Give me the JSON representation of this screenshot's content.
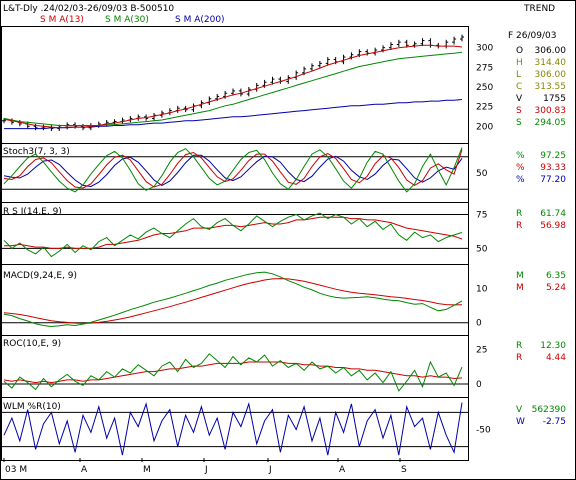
{
  "header": {
    "title": "L&T-Dly .24/02/03-26/09/03  B-500510",
    "sma13_label": "S M A(13)",
    "sma30_label": "S M A(30)",
    "sma200_label": "S M A(200)",
    "trend_label": "TREND"
  },
  "colors": {
    "frame": "#000000",
    "price_bars": "#000000",
    "sma13": "#cc0000",
    "sma30": "#008800",
    "sma200": "#0000aa",
    "k_line": "#008800",
    "d_line": "#cc0000",
    "slow_line": "#0000aa",
    "value_text": "#000000",
    "r_text": "#cc0000"
  },
  "info_panels": [
    {
      "date": "F 26/09/03",
      "rows": [
        {
          "k": "O",
          "v": "306.00",
          "color": "#000000"
        },
        {
          "k": "H",
          "v": "314.40",
          "color": "#888800"
        },
        {
          "k": "L",
          "v": "306.00",
          "color": "#888800"
        },
        {
          "k": "C",
          "v": "313.55",
          "color": "#888800"
        },
        {
          "k": "V",
          "v": "1755",
          "color": "#000000"
        },
        {
          "k": "S",
          "v": "300.83",
          "color": "#cc0000"
        },
        {
          "k": "S",
          "v": "294.05",
          "color": "#008800"
        }
      ]
    },
    {
      "rows": [
        {
          "k": "%",
          "v": "97.25",
          "color": "#008800"
        },
        {
          "k": "%",
          "v": "93.33",
          "color": "#cc0000"
        },
        {
          "k": "%",
          "v": "77.20",
          "color": "#0000aa"
        }
      ]
    },
    {
      "rows": [
        {
          "k": "R",
          "v": "61.74",
          "color": "#008800"
        },
        {
          "k": "R",
          "v": "56.98",
          "color": "#cc0000"
        }
      ]
    },
    {
      "rows": [
        {
          "k": "M",
          "v": "6.35",
          "color": "#008800"
        },
        {
          "k": "M",
          "v": "5.24",
          "color": "#cc0000"
        }
      ]
    },
    {
      "rows": [
        {
          "k": "R",
          "v": "12.30",
          "color": "#008800"
        },
        {
          "k": "R",
          "v": "4.44",
          "color": "#cc0000"
        }
      ]
    },
    {
      "rows": [
        {
          "k": "V",
          "v": "562390",
          "color": "#008800"
        },
        {
          "k": "W",
          "v": "-2.75",
          "color": "#0000aa"
        }
      ]
    }
  ],
  "chart_data": {
    "type": "line",
    "x_labels": [
      "03 M",
      "A",
      "M",
      "J",
      "J",
      "A",
      "S"
    ],
    "panels": [
      {
        "name": "price",
        "type": "ohlc",
        "ylim": [
          180,
          325
        ],
        "yticks": [
          200,
          225,
          250,
          275,
          300
        ],
        "close": [
          207,
          205,
          203,
          200,
          198,
          199,
          197,
          199,
          202,
          200,
          198,
          201,
          203,
          205,
          206,
          208,
          210,
          212,
          210,
          214,
          217,
          220,
          223,
          221,
          226,
          230,
          235,
          238,
          242,
          245,
          241,
          247,
          252,
          256,
          260,
          257,
          262,
          268,
          273,
          277,
          280,
          285,
          282,
          288,
          291,
          295,
          293,
          297,
          300,
          304,
          307,
          303,
          305,
          309,
          303,
          302,
          307,
          311,
          313.55
        ],
        "sma13": [
          209,
          207,
          205,
          203,
          201,
          200,
          199,
          198,
          199,
          199,
          199,
          200,
          201,
          203,
          204,
          206,
          208,
          210,
          211,
          213,
          215,
          217,
          220,
          222,
          225,
          228,
          231,
          234,
          237,
          240,
          242,
          245,
          248,
          251,
          254,
          257,
          260,
          263,
          267,
          270,
          274,
          278,
          281,
          284,
          287,
          290,
          292,
          294,
          296,
          298,
          300,
          301,
          302,
          303,
          303,
          302,
          302,
          302,
          300.83
        ],
        "sma30": [
          210,
          208,
          206,
          205,
          204,
          203,
          202,
          201,
          201,
          201,
          201,
          201,
          201,
          202,
          202,
          203,
          204,
          205,
          206,
          207,
          208,
          210,
          212,
          214,
          216,
          218,
          220,
          223,
          226,
          228,
          231,
          234,
          237,
          240,
          243,
          246,
          249,
          252,
          255,
          258,
          261,
          264,
          267,
          270,
          273,
          276,
          278,
          280,
          282,
          284,
          286,
          287,
          288,
          289,
          290,
          291,
          292,
          293,
          294.05
        ],
        "sma200": [
          197,
          197,
          197,
          197,
          197,
          197,
          198,
          198,
          198,
          199,
          199,
          199,
          200,
          200,
          201,
          201,
          202,
          202,
          203,
          204,
          204,
          205,
          206,
          207,
          207,
          208,
          209,
          210,
          211,
          212,
          212,
          213,
          214,
          215,
          216,
          217,
          218,
          219,
          220,
          221,
          222,
          223,
          224,
          225,
          226,
          226,
          227,
          228,
          228,
          229,
          230,
          230,
          231,
          231,
          232,
          232,
          233,
          233,
          234
        ]
      },
      {
        "name": "Stoch3(7, 3, 3)",
        "ylim": [
          0,
          100
        ],
        "yticks": [
          50
        ],
        "hlines": [
          20,
          80
        ],
        "k": [
          30,
          45,
          62,
          78,
          85,
          70,
          52,
          35,
          22,
          15,
          28,
          48,
          66,
          82,
          90,
          78,
          55,
          30,
          18,
          25,
          45,
          70,
          88,
          95,
          80,
          60,
          40,
          28,
          35,
          55,
          75,
          88,
          92,
          75,
          50,
          30,
          20,
          38,
          62,
          85,
          93,
          80,
          58,
          35,
          22,
          40,
          70,
          90,
          85,
          60,
          35,
          15,
          30,
          62,
          85,
          55,
          28,
          60,
          97.25
        ],
        "d": [
          40,
          38,
          45,
          62,
          75,
          78,
          69,
          52,
          36,
          24,
          22,
          30,
          47,
          65,
          79,
          83,
          74,
          54,
          34,
          24,
          29,
          47,
          68,
          84,
          88,
          78,
          60,
          43,
          34,
          39,
          55,
          73,
          85,
          85,
          72,
          52,
          33,
          29,
          40,
          62,
          80,
          86,
          77,
          58,
          38,
          32,
          44,
          67,
          82,
          78,
          60,
          37,
          27,
          36,
          59,
          67,
          56,
          48,
          93.33
        ],
        "slow": [
          45,
          42,
          41,
          48,
          61,
          72,
          74,
          66,
          51,
          37,
          27,
          25,
          33,
          47,
          64,
          76,
          79,
          70,
          54,
          37,
          27,
          35,
          51,
          69,
          83,
          83,
          72,
          56,
          41,
          36,
          43,
          57,
          71,
          81,
          80,
          70,
          52,
          38,
          34,
          44,
          61,
          76,
          81,
          72,
          55,
          43,
          38,
          48,
          64,
          76,
          74,
          58,
          41,
          33,
          41,
          54,
          61,
          57,
          77.2
        ]
      },
      {
        "name": "R S I(14,E, 9)",
        "ylim": [
          40,
          82
        ],
        "yticks": [
          50,
          75
        ],
        "hlines": [
          50,
          75
        ],
        "rsi": [
          56,
          50,
          54,
          49,
          46,
          51,
          44,
          48,
          53,
          47,
          52,
          49,
          55,
          58,
          52,
          56,
          60,
          57,
          62,
          65,
          61,
          58,
          63,
          68,
          72,
          66,
          64,
          69,
          72,
          67,
          63,
          68,
          74,
          70,
          66,
          70,
          73,
          75,
          71,
          74,
          76,
          72,
          75,
          73,
          68,
          72,
          66,
          70,
          64,
          68,
          60,
          56,
          62,
          58,
          60,
          55,
          58,
          60,
          61.74
        ],
        "signal": [
          52,
          52,
          53,
          52,
          51,
          51,
          50,
          50,
          51,
          50,
          50,
          50,
          51,
          53,
          53,
          54,
          55,
          56,
          58,
          60,
          61,
          61,
          62,
          63,
          65,
          65,
          65,
          66,
          67,
          67,
          66,
          67,
          68,
          69,
          68,
          68,
          69,
          71,
          71,
          72,
          73,
          73,
          73,
          73,
          72,
          72,
          71,
          71,
          70,
          69,
          67,
          65,
          64,
          63,
          62,
          61,
          60,
          59,
          56.98
        ]
      },
      {
        "name": "MACD(9,24,E, 9)",
        "ylim": [
          -3,
          16
        ],
        "yticks": [
          10,
          0
        ],
        "hlines": [
          0
        ],
        "macd": [
          2.5,
          2.1,
          1.2,
          0.5,
          -0.3,
          -0.8,
          -1.1,
          -0.9,
          -0.6,
          -0.8,
          -0.4,
          0.1,
          0.8,
          1.5,
          2.2,
          3.0,
          3.8,
          4.5,
          5.2,
          6.0,
          6.6,
          7.2,
          7.9,
          8.6,
          9.4,
          10.1,
          10.9,
          11.6,
          12.4,
          13.0,
          13.6,
          14.2,
          14.6,
          14.8,
          14.3,
          13.4,
          12.3,
          11.4,
          10.4,
          9.6,
          8.6,
          7.9,
          7.4,
          7.2,
          7.3,
          7.4,
          7.6,
          7.3,
          6.9,
          6.6,
          6.4,
          5.9,
          5.4,
          5.6,
          4.5,
          3.5,
          3.9,
          5.1,
          6.35
        ],
        "signal": [
          2.9,
          2.7,
          2.4,
          2.0,
          1.5,
          1.0,
          0.6,
          0.3,
          0.1,
          -0.1,
          -0.2,
          -0.1,
          0.1,
          0.4,
          0.8,
          1.2,
          1.7,
          2.3,
          2.9,
          3.5,
          4.1,
          4.7,
          5.4,
          6.0,
          6.7,
          7.4,
          8.1,
          8.8,
          9.5,
          10.2,
          10.9,
          11.5,
          12.0,
          12.5,
          12.8,
          12.9,
          12.8,
          12.5,
          12.1,
          11.6,
          11.0,
          10.4,
          9.8,
          9.3,
          8.9,
          8.6,
          8.4,
          8.2,
          7.9,
          7.6,
          7.4,
          7.1,
          6.8,
          6.5,
          6.1,
          5.6,
          5.3,
          5.2,
          5.24
        ]
      },
      {
        "name": "ROC(10,E, 9)",
        "ylim": [
          -8,
          32
        ],
        "yticks": [
          25,
          0
        ],
        "hlines": [
          0
        ],
        "roc": [
          2,
          -3,
          5,
          1,
          -4,
          4,
          -2,
          3,
          7,
          2,
          -1,
          6,
          3,
          9,
          5,
          11,
          8,
          14,
          10,
          6,
          13,
          16,
          9,
          18,
          12,
          15,
          22,
          17,
          12,
          20,
          14,
          19,
          16,
          21,
          13,
          17,
          12,
          15,
          10,
          16,
          11,
          13,
          8,
          12,
          6,
          10,
          3,
          8,
          1,
          9,
          -5,
          2,
          10,
          -2,
          16,
          5,
          8,
          -1,
          12.3
        ],
        "signal": [
          3,
          2,
          3,
          2,
          1,
          2,
          1,
          2,
          3,
          3,
          2,
          3,
          3,
          4,
          5,
          6,
          7,
          8,
          9,
          9,
          10,
          11,
          11,
          12,
          13,
          13,
          14,
          15,
          15,
          15,
          15,
          16,
          16,
          16,
          16,
          16,
          15,
          15,
          14,
          14,
          13,
          13,
          12,
          12,
          11,
          11,
          10,
          10,
          9,
          8,
          7,
          6,
          6,
          5,
          6,
          5,
          5,
          4,
          4.44
        ]
      },
      {
        "name": "WLM %R(10)",
        "ylim": [
          -100,
          0
        ],
        "yticks": [
          -50
        ],
        "hlines": [
          -20,
          -80
        ],
        "wr": [
          -60,
          -30,
          -70,
          -15,
          -85,
          -40,
          -20,
          -75,
          -35,
          -90,
          -25,
          -55,
          -10,
          -65,
          -30,
          -95,
          -20,
          -45,
          -5,
          -70,
          -35,
          -15,
          -80,
          -25,
          -55,
          -10,
          -60,
          -30,
          -85,
          -20,
          -45,
          -5,
          -75,
          -35,
          -15,
          -90,
          -25,
          -50,
          -10,
          -70,
          -30,
          -95,
          -20,
          -55,
          -5,
          -80,
          -35,
          -15,
          -65,
          -25,
          -95,
          -10,
          -45,
          -30,
          -85,
          -20,
          -60,
          -90,
          -2.75
        ]
      }
    ]
  }
}
